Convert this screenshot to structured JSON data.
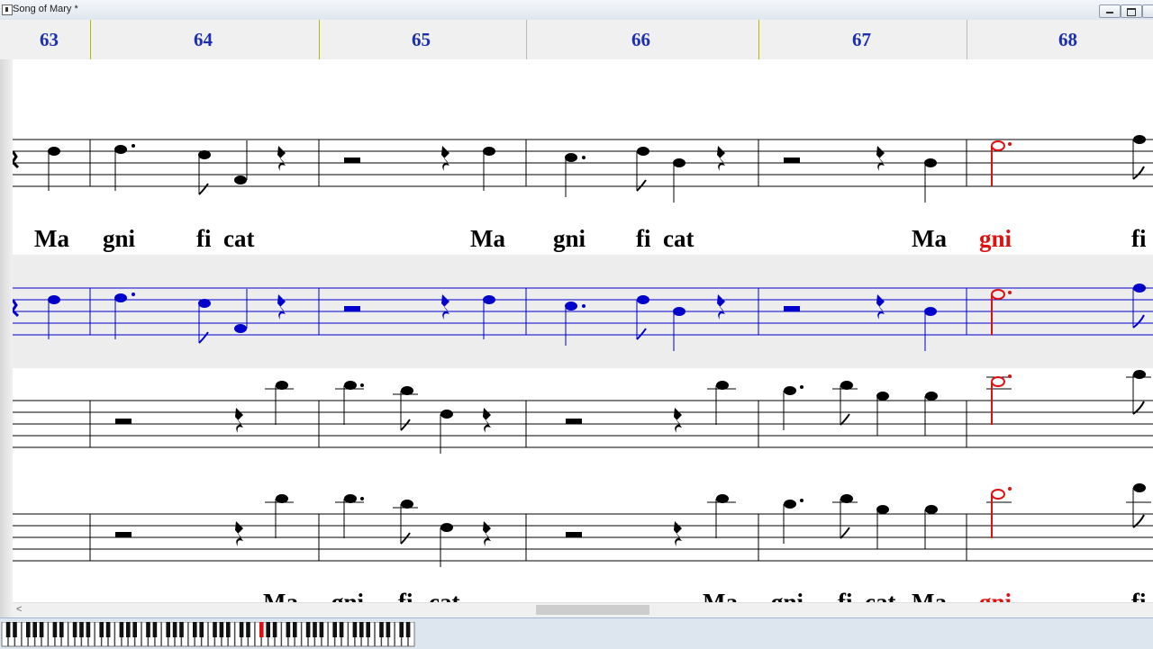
{
  "window": {
    "title": "Song of Mary *",
    "buttons": [
      "minimize",
      "maximize",
      "close"
    ]
  },
  "ruler": {
    "measures": [
      "63",
      "64",
      "65",
      "66",
      "67",
      "68"
    ]
  },
  "staves": [
    {
      "name": "staff-1-vocal",
      "color": "#000000"
    },
    {
      "name": "staff-2-selected",
      "color": "#0000cc",
      "selected": true
    },
    {
      "name": "staff-3",
      "color": "#000000"
    },
    {
      "name": "staff-4",
      "color": "#000000"
    }
  ],
  "lyrics": {
    "line1": [
      "Ma",
      "gni",
      "fi",
      "cat",
      "Ma",
      "gni",
      "fi",
      "cat",
      "Ma",
      "gni",
      "fi"
    ],
    "line1_highlight_index": 9,
    "line2": [
      "Ma",
      "gni",
      "fi",
      "cat",
      "Ma",
      "gni",
      "fi",
      "cat",
      "Ma",
      "gni",
      "fi"
    ],
    "line2_highlight_index": 9
  },
  "colors": {
    "selection": "#0000cc",
    "playhead_note": "#e01010",
    "measure_numbers": "#1c2fb0"
  },
  "scrollbar": {
    "left_arrow": "<"
  },
  "keyboard": {
    "pressed_key_color": "#e01010"
  }
}
